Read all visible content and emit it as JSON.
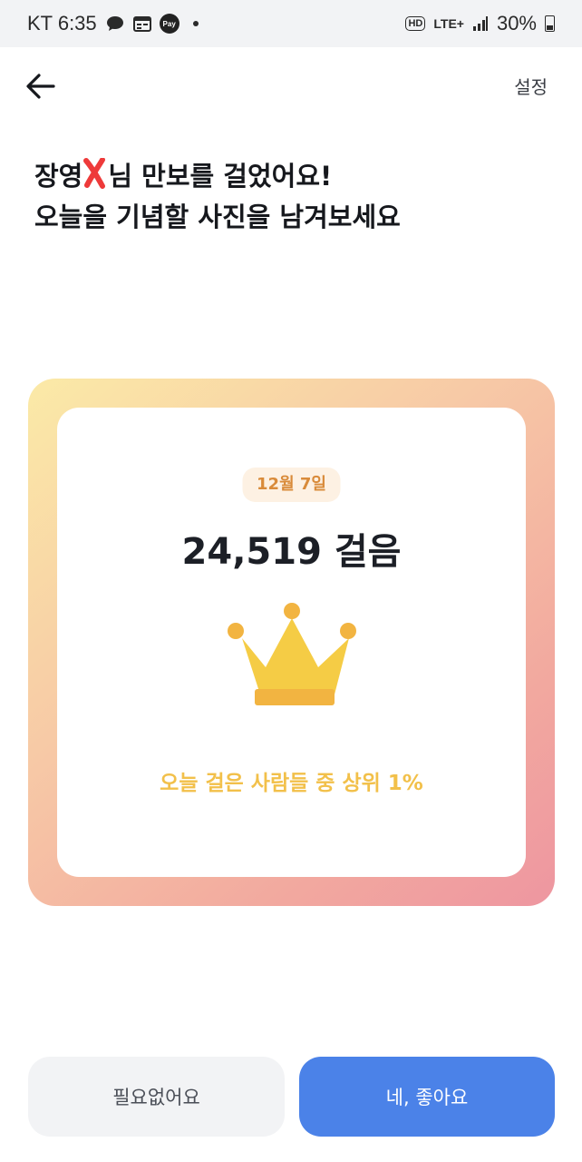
{
  "status_bar": {
    "carrier_time": "KT 6:35",
    "pay_label": "Pay",
    "hd_label": "HD",
    "network_label": "LTE+",
    "battery_text": "30%"
  },
  "header": {
    "settings_label": "설정"
  },
  "headline": {
    "line1_prefix": "장영",
    "line1_suffix": "님 만보를 걸었어요!",
    "line2": "오늘을 기념할 사진을 남겨보세요"
  },
  "card": {
    "date": "12월 7일",
    "steps": "24,519 걸음",
    "rank_text": "오늘 걸은 사람들 중 상위 1%"
  },
  "buttons": {
    "decline_label": "필요없어요",
    "accept_label": "네, 좋아요"
  },
  "colors": {
    "accent": "#4b82e8",
    "crown": "#f5cc45",
    "rank_text": "#f2c04a",
    "date_text": "#d98b3a"
  }
}
